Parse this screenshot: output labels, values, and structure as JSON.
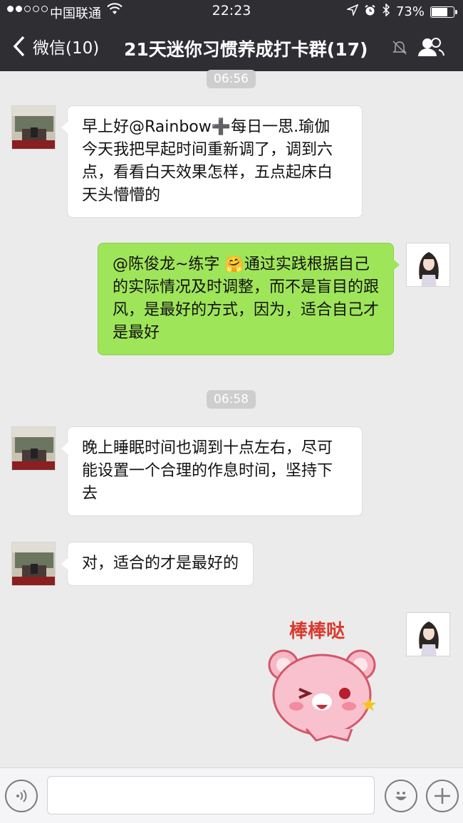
{
  "status_bar": {
    "carrier": "中国联通",
    "time": "22:23",
    "battery": "73%",
    "battery_level": 0.73
  },
  "nav": {
    "back_label": "微信(10)",
    "title": "21天迷你习惯养成打卡群(17)"
  },
  "messages": [
    {
      "kind": "time",
      "text": "06:56"
    },
    {
      "kind": "in",
      "text": "早上好@Rainbow➕每日一思.瑜伽　今天我把早起时间重新调了，调到六点，看看白天效果怎样，五点起床白天头懵懵的"
    },
    {
      "kind": "out",
      "text": "@陈俊龙~练字 🤗通过实践根据自己的实际情况及时调整，而不是盲目的跟风，是最好的方式，因为，适合自己才是最好"
    },
    {
      "kind": "time",
      "text": "06:58"
    },
    {
      "kind": "in",
      "text": "晚上睡眠时间也调到十点左右，尽可能设置一个合理的作息时间，坚持下去"
    },
    {
      "kind": "in",
      "text": "对，适合的才是最好的"
    },
    {
      "kind": "out-sticker",
      "caption": "棒棒哒"
    }
  ],
  "composer": {
    "voice_icon": "voice-icon",
    "emoji_icon": "emoji-icon",
    "plus_icon": "plus-icon",
    "input_value": ""
  },
  "colors": {
    "topbar": "#2e2e33",
    "chat_bg": "#ebebeb",
    "bubble_out": "#9fe55a",
    "bubble_in": "#ffffff"
  }
}
